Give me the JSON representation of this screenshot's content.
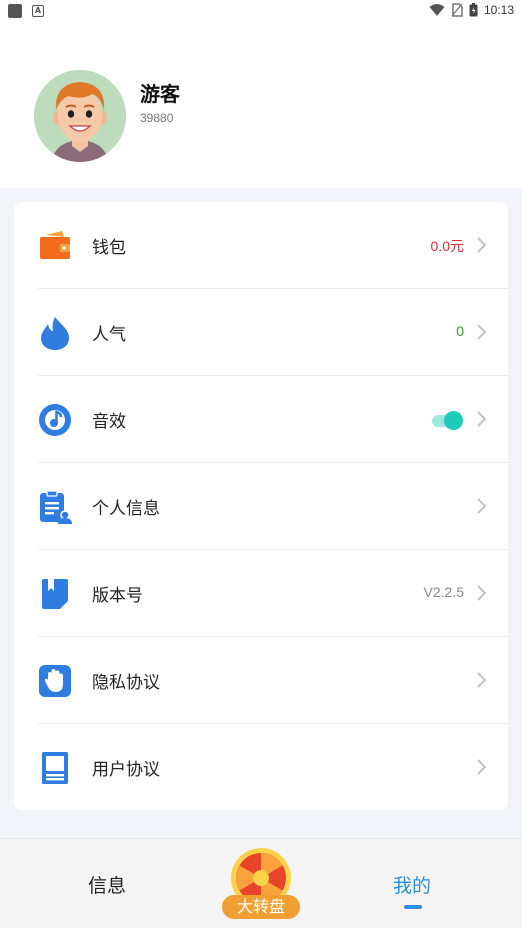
{
  "status_bar": {
    "time": "10:13"
  },
  "profile": {
    "name": "游客",
    "id": "39880"
  },
  "menu": [
    {
      "label": "钱包",
      "value": "0.0元",
      "value_color": "#d0342c",
      "icon": "wallet-icon"
    },
    {
      "label": "人气",
      "value": "0",
      "value_color": "#3a9a2a",
      "icon": "flame-icon"
    },
    {
      "label": "音效",
      "value": "",
      "toggle_on": true,
      "icon": "music-note-icon"
    },
    {
      "label": "个人信息",
      "value": "",
      "icon": "profile-document-icon"
    },
    {
      "label": "版本号",
      "value": "V2.2.5",
      "value_color": "#888888",
      "icon": "bookmark-book-icon"
    },
    {
      "label": "隐私协议",
      "value": "",
      "icon": "hand-stop-icon"
    },
    {
      "label": "用户协议",
      "value": "",
      "icon": "agreement-document-icon"
    }
  ],
  "tabbar": {
    "info_label": "信息",
    "wheel_label": "大转盘",
    "mine_label": "我的",
    "active_color": "#2f8fdc"
  }
}
